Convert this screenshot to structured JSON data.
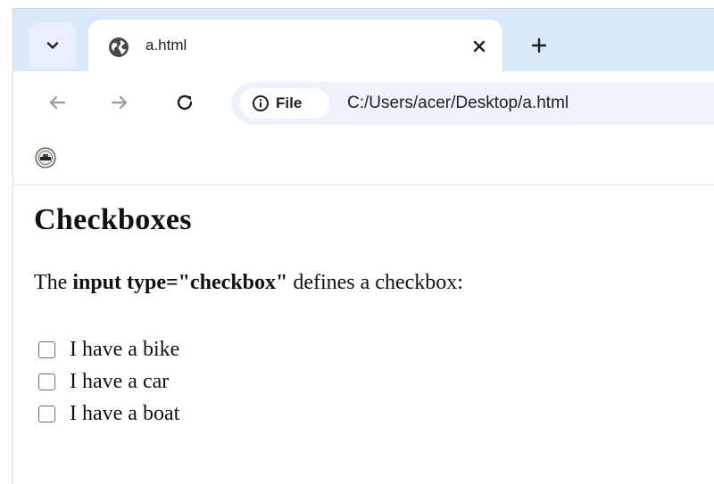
{
  "browser": {
    "tab": {
      "title": "a.html",
      "favicon": "globe-icon"
    },
    "toolbar": {
      "site_info_label": "File",
      "url": "C:/Users/acer/Desktop/a.html"
    }
  },
  "page": {
    "heading": "Checkboxes",
    "intro": {
      "prefix": "The ",
      "code": "input type=\"checkbox\"",
      "suffix": " defines a checkbox:"
    },
    "checkboxes": [
      {
        "label": "I have a bike",
        "checked": false
      },
      {
        "label": "I have a car",
        "checked": false
      },
      {
        "label": "I have a boat",
        "checked": false
      }
    ]
  },
  "colors": {
    "tabstrip": "#dbe7fb",
    "omnibox": "#eef2fa",
    "text": "#111111"
  }
}
